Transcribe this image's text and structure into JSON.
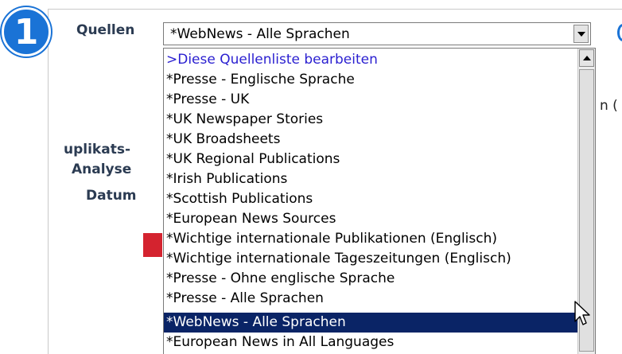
{
  "step_badge": "1",
  "labels": {
    "sources": "Quellen",
    "duplicate_line1": "uplikats-",
    "duplicate_line2": "Analyse",
    "date": "Datum",
    "clipped_right": "n ("
  },
  "sources_select": {
    "value": "*WebNews - Alle Sprachen"
  },
  "dropdown_options": [
    ">Diese Quellenliste bearbeiten",
    "*Presse - Englische Sprache",
    "*Presse - UK",
    "*UK Newspaper Stories",
    "*UK Broadsheets",
    "*UK Regional Publications",
    "*Irish Publications",
    "*Scottish Publications",
    "*European News Sources",
    "*Wichtige internationale Publikationen (Englisch)",
    "*Wichtige internationale Tageszeitungen (Englisch)",
    "*Presse - Ohne englische Sprache",
    "*Presse - Alle Sprachen",
    "*WebNews - Alle Sprachen",
    "*European News in All Languages"
  ],
  "selected_index": 13,
  "colors": {
    "badge": "#1a73d6",
    "selected_bg": "#0a2466",
    "edit_link": "#2a1fd0",
    "red_button": "#d4232f"
  }
}
